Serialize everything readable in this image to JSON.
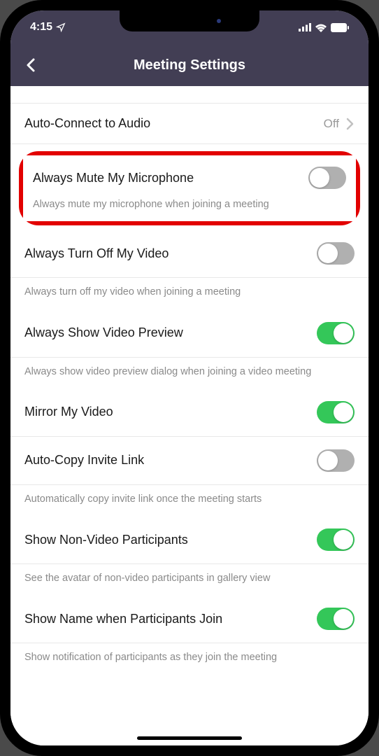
{
  "status": {
    "time": "4:15"
  },
  "nav": {
    "title": "Meeting Settings"
  },
  "rows": {
    "autoConnect": {
      "title": "Auto-Connect to Audio",
      "value": "Off"
    },
    "mute": {
      "title": "Always Mute My Microphone",
      "desc": "Always mute my microphone when joining a meeting",
      "on": false
    },
    "video": {
      "title": "Always Turn Off My Video",
      "desc": "Always turn off my video when joining a meeting",
      "on": false
    },
    "preview": {
      "title": "Always Show Video Preview",
      "desc": "Always show video preview dialog when joining a video meeting",
      "on": true
    },
    "mirror": {
      "title": "Mirror My Video",
      "on": true
    },
    "autoCopy": {
      "title": "Auto-Copy Invite Link",
      "desc": "Automatically copy invite link once the meeting starts",
      "on": false
    },
    "nonVideo": {
      "title": "Show Non-Video Participants",
      "desc": "See the avatar of non-video participants in gallery view",
      "on": true
    },
    "showName": {
      "title": "Show Name when Participants Join",
      "desc": "Show notification of participants as they join the meeting",
      "on": true
    }
  }
}
